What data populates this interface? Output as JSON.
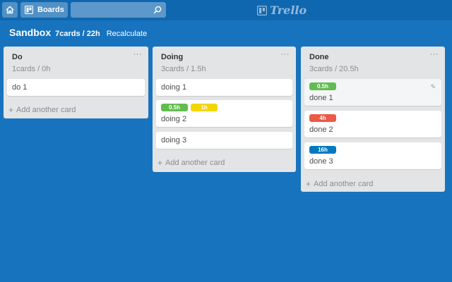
{
  "header": {
    "boards_label": "Boards",
    "search_value": "",
    "logo_text": "Trello"
  },
  "board": {
    "title": "Sandbox",
    "stats": "7cards / 22h",
    "recalculate_label": "Recalculate"
  },
  "lists": [
    {
      "title": "Do",
      "menu": "···",
      "summary": "1cards / 0h",
      "cards": [
        {
          "title": "do 1",
          "labels": []
        }
      ],
      "add_label": "Add another card"
    },
    {
      "title": "Doing",
      "menu": "···",
      "summary": "3cards / 1.5h",
      "cards": [
        {
          "title": "doing 1",
          "labels": []
        },
        {
          "title": "doing 2",
          "labels": [
            {
              "text": "0.5h",
              "color": "#61bd4f"
            },
            {
              "text": "1h",
              "color": "#f2d600"
            }
          ]
        },
        {
          "title": "doing 3",
          "labels": []
        }
      ],
      "add_label": "Add another card"
    },
    {
      "title": "Done",
      "menu": "···",
      "summary": "3cards / 20.5h",
      "cards": [
        {
          "title": "done 1",
          "labels": [
            {
              "text": "0.5h",
              "color": "#61bd4f"
            }
          ]
        },
        {
          "title": "done 2",
          "labels": [
            {
              "text": "4h",
              "color": "#eb5a46"
            }
          ]
        },
        {
          "title": "done 3",
          "labels": [
            {
              "text": "16h",
              "color": "#0079bf"
            }
          ]
        }
      ],
      "add_label": "Add another card"
    }
  ],
  "colors": {
    "background": "#1873be",
    "header": "#0f67b0",
    "list": "#e2e4e6",
    "green": "#61bd4f",
    "yellow": "#f2d600",
    "red": "#eb5a46",
    "blue": "#0079bf"
  },
  "icons": {
    "home": "home-icon",
    "boards": "boards-icon",
    "search": "search-icon",
    "logo": "trello-logo-icon",
    "edit": "pencil-icon",
    "add": "plus-icon"
  }
}
